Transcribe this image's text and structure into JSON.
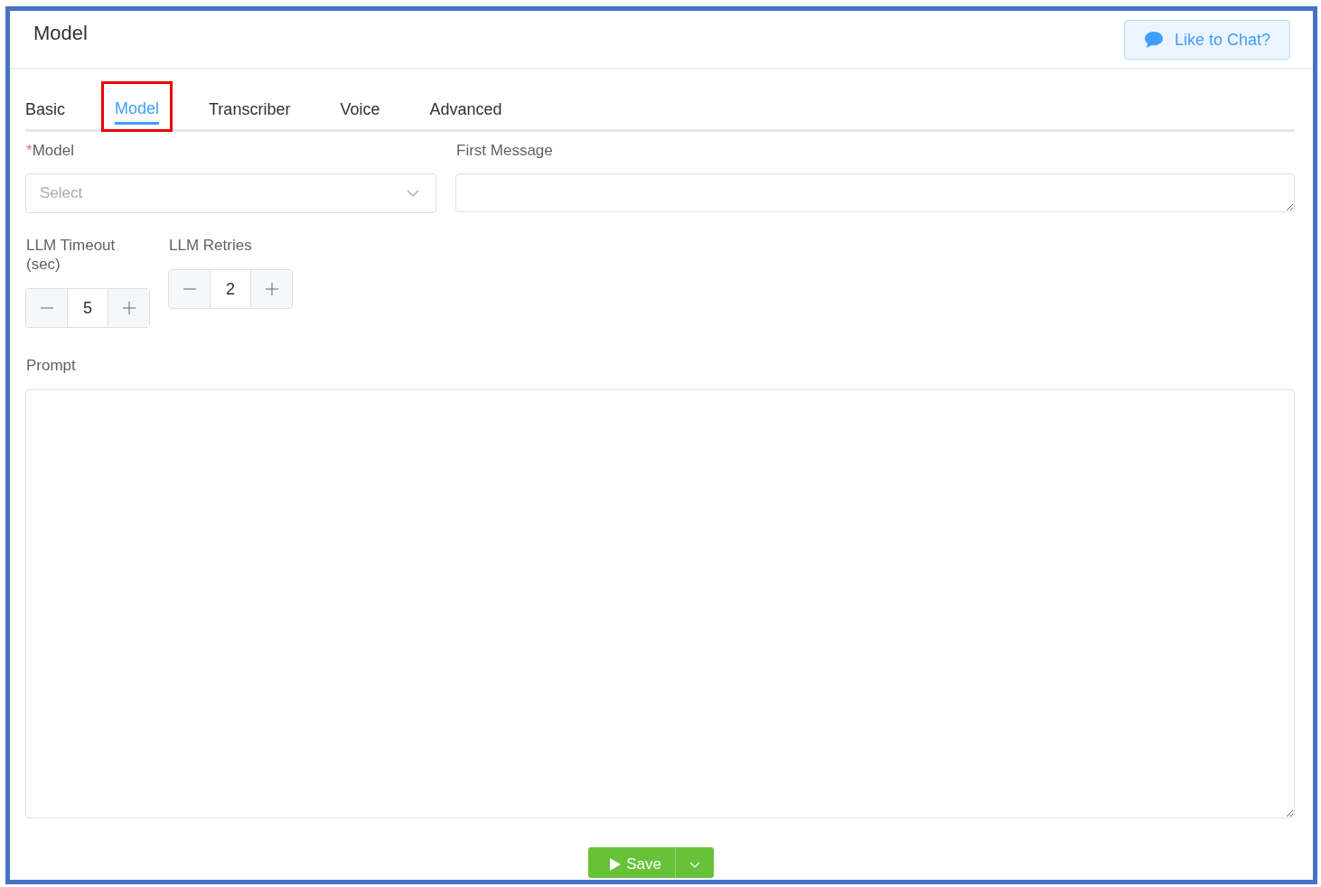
{
  "header": {
    "title": "Model",
    "chat_button": "Like to Chat?"
  },
  "tabs": [
    {
      "label": "Basic",
      "selected": false
    },
    {
      "label": "Model",
      "selected": true
    },
    {
      "label": "Transcriber",
      "selected": false
    },
    {
      "label": "Voice",
      "selected": false
    },
    {
      "label": "Advanced",
      "selected": false
    }
  ],
  "model_field": {
    "label": "Model",
    "required_mark": "*",
    "placeholder": "Select"
  },
  "first_message": {
    "label": "First Message"
  },
  "timeout": {
    "label": "LLM Timeout (sec)",
    "value": "5"
  },
  "retries": {
    "label": "LLM Retries",
    "value": "2"
  },
  "prompt": {
    "label": "Prompt"
  },
  "save_button": "Save"
}
